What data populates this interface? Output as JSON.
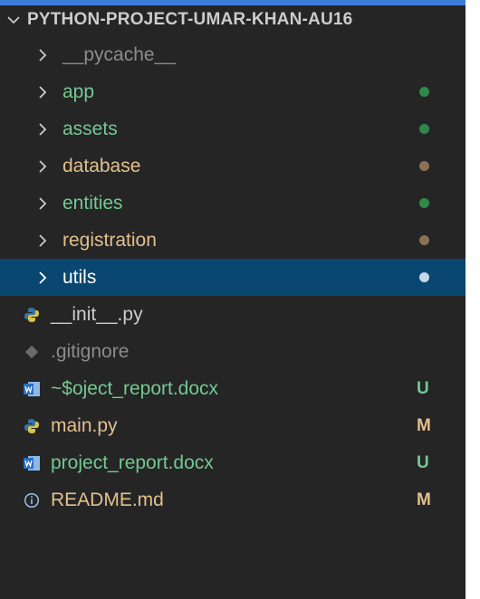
{
  "colors": {
    "background": "#252526",
    "selected": "#094771",
    "untracked": "#73c991",
    "modified": "#e2c08d",
    "ignored": "#8c8c8c",
    "default": "#cccccc",
    "selected_dot": "#c5d9ea"
  },
  "explorer": {
    "section_title": "PYTHON-PROJECT-UMAR-KHAN-AU16",
    "section_icon": "chevron-down-icon",
    "folders": [
      {
        "label": "__pycache__",
        "status": "ignored",
        "decoration": "none"
      },
      {
        "label": "app",
        "status": "untracked",
        "decoration": "dot"
      },
      {
        "label": "assets",
        "status": "untracked",
        "decoration": "dot"
      },
      {
        "label": "database",
        "status": "modified",
        "decoration": "dot"
      },
      {
        "label": "entities",
        "status": "untracked",
        "decoration": "dot"
      },
      {
        "label": "registration",
        "status": "modified",
        "decoration": "dot"
      },
      {
        "label": "utils",
        "status": "selected",
        "decoration": "dot",
        "selected": true
      }
    ],
    "files": [
      {
        "label": "__init__.py",
        "icon": "python-file-icon",
        "status": "default",
        "badge": ""
      },
      {
        "label": ".gitignore",
        "icon": "git-file-icon",
        "status": "ignored",
        "badge": ""
      },
      {
        "label": "~$oject_report.docx",
        "icon": "word-file-icon",
        "status": "untracked",
        "badge": "U"
      },
      {
        "label": "main.py",
        "icon": "python-file-icon",
        "status": "modified",
        "badge": "M"
      },
      {
        "label": "project_report.docx",
        "icon": "word-file-icon",
        "status": "untracked",
        "badge": "U"
      },
      {
        "label": "README.md",
        "icon": "info-icon",
        "status": "modified",
        "badge": "M"
      }
    ]
  }
}
